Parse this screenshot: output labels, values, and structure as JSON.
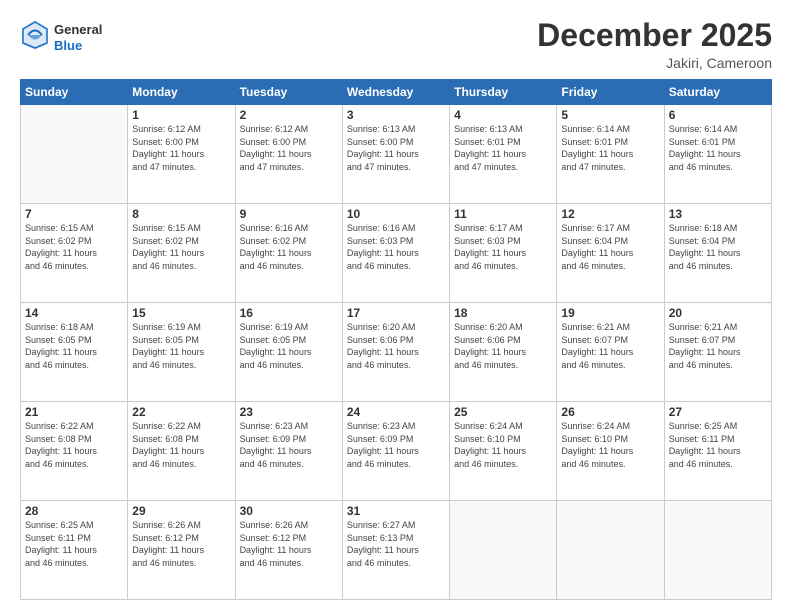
{
  "header": {
    "logo_line1": "General",
    "logo_line2": "Blue",
    "month": "December 2025",
    "location": "Jakiri, Cameroon"
  },
  "days_of_week": [
    "Sunday",
    "Monday",
    "Tuesday",
    "Wednesday",
    "Thursday",
    "Friday",
    "Saturday"
  ],
  "weeks": [
    [
      {
        "day": "",
        "info": ""
      },
      {
        "day": "1",
        "info": "Sunrise: 6:12 AM\nSunset: 6:00 PM\nDaylight: 11 hours\nand 47 minutes."
      },
      {
        "day": "2",
        "info": "Sunrise: 6:12 AM\nSunset: 6:00 PM\nDaylight: 11 hours\nand 47 minutes."
      },
      {
        "day": "3",
        "info": "Sunrise: 6:13 AM\nSunset: 6:00 PM\nDaylight: 11 hours\nand 47 minutes."
      },
      {
        "day": "4",
        "info": "Sunrise: 6:13 AM\nSunset: 6:01 PM\nDaylight: 11 hours\nand 47 minutes."
      },
      {
        "day": "5",
        "info": "Sunrise: 6:14 AM\nSunset: 6:01 PM\nDaylight: 11 hours\nand 47 minutes."
      },
      {
        "day": "6",
        "info": "Sunrise: 6:14 AM\nSunset: 6:01 PM\nDaylight: 11 hours\nand 46 minutes."
      }
    ],
    [
      {
        "day": "7",
        "info": "Sunrise: 6:15 AM\nSunset: 6:02 PM\nDaylight: 11 hours\nand 46 minutes."
      },
      {
        "day": "8",
        "info": "Sunrise: 6:15 AM\nSunset: 6:02 PM\nDaylight: 11 hours\nand 46 minutes."
      },
      {
        "day": "9",
        "info": "Sunrise: 6:16 AM\nSunset: 6:02 PM\nDaylight: 11 hours\nand 46 minutes."
      },
      {
        "day": "10",
        "info": "Sunrise: 6:16 AM\nSunset: 6:03 PM\nDaylight: 11 hours\nand 46 minutes."
      },
      {
        "day": "11",
        "info": "Sunrise: 6:17 AM\nSunset: 6:03 PM\nDaylight: 11 hours\nand 46 minutes."
      },
      {
        "day": "12",
        "info": "Sunrise: 6:17 AM\nSunset: 6:04 PM\nDaylight: 11 hours\nand 46 minutes."
      },
      {
        "day": "13",
        "info": "Sunrise: 6:18 AM\nSunset: 6:04 PM\nDaylight: 11 hours\nand 46 minutes."
      }
    ],
    [
      {
        "day": "14",
        "info": "Sunrise: 6:18 AM\nSunset: 6:05 PM\nDaylight: 11 hours\nand 46 minutes."
      },
      {
        "day": "15",
        "info": "Sunrise: 6:19 AM\nSunset: 6:05 PM\nDaylight: 11 hours\nand 46 minutes."
      },
      {
        "day": "16",
        "info": "Sunrise: 6:19 AM\nSunset: 6:05 PM\nDaylight: 11 hours\nand 46 minutes."
      },
      {
        "day": "17",
        "info": "Sunrise: 6:20 AM\nSunset: 6:06 PM\nDaylight: 11 hours\nand 46 minutes."
      },
      {
        "day": "18",
        "info": "Sunrise: 6:20 AM\nSunset: 6:06 PM\nDaylight: 11 hours\nand 46 minutes."
      },
      {
        "day": "19",
        "info": "Sunrise: 6:21 AM\nSunset: 6:07 PM\nDaylight: 11 hours\nand 46 minutes."
      },
      {
        "day": "20",
        "info": "Sunrise: 6:21 AM\nSunset: 6:07 PM\nDaylight: 11 hours\nand 46 minutes."
      }
    ],
    [
      {
        "day": "21",
        "info": "Sunrise: 6:22 AM\nSunset: 6:08 PM\nDaylight: 11 hours\nand 46 minutes."
      },
      {
        "day": "22",
        "info": "Sunrise: 6:22 AM\nSunset: 6:08 PM\nDaylight: 11 hours\nand 46 minutes."
      },
      {
        "day": "23",
        "info": "Sunrise: 6:23 AM\nSunset: 6:09 PM\nDaylight: 11 hours\nand 46 minutes."
      },
      {
        "day": "24",
        "info": "Sunrise: 6:23 AM\nSunset: 6:09 PM\nDaylight: 11 hours\nand 46 minutes."
      },
      {
        "day": "25",
        "info": "Sunrise: 6:24 AM\nSunset: 6:10 PM\nDaylight: 11 hours\nand 46 minutes."
      },
      {
        "day": "26",
        "info": "Sunrise: 6:24 AM\nSunset: 6:10 PM\nDaylight: 11 hours\nand 46 minutes."
      },
      {
        "day": "27",
        "info": "Sunrise: 6:25 AM\nSunset: 6:11 PM\nDaylight: 11 hours\nand 46 minutes."
      }
    ],
    [
      {
        "day": "28",
        "info": "Sunrise: 6:25 AM\nSunset: 6:11 PM\nDaylight: 11 hours\nand 46 minutes."
      },
      {
        "day": "29",
        "info": "Sunrise: 6:26 AM\nSunset: 6:12 PM\nDaylight: 11 hours\nand 46 minutes."
      },
      {
        "day": "30",
        "info": "Sunrise: 6:26 AM\nSunset: 6:12 PM\nDaylight: 11 hours\nand 46 minutes."
      },
      {
        "day": "31",
        "info": "Sunrise: 6:27 AM\nSunset: 6:13 PM\nDaylight: 11 hours\nand 46 minutes."
      },
      {
        "day": "",
        "info": ""
      },
      {
        "day": "",
        "info": ""
      },
      {
        "day": "",
        "info": ""
      }
    ]
  ]
}
